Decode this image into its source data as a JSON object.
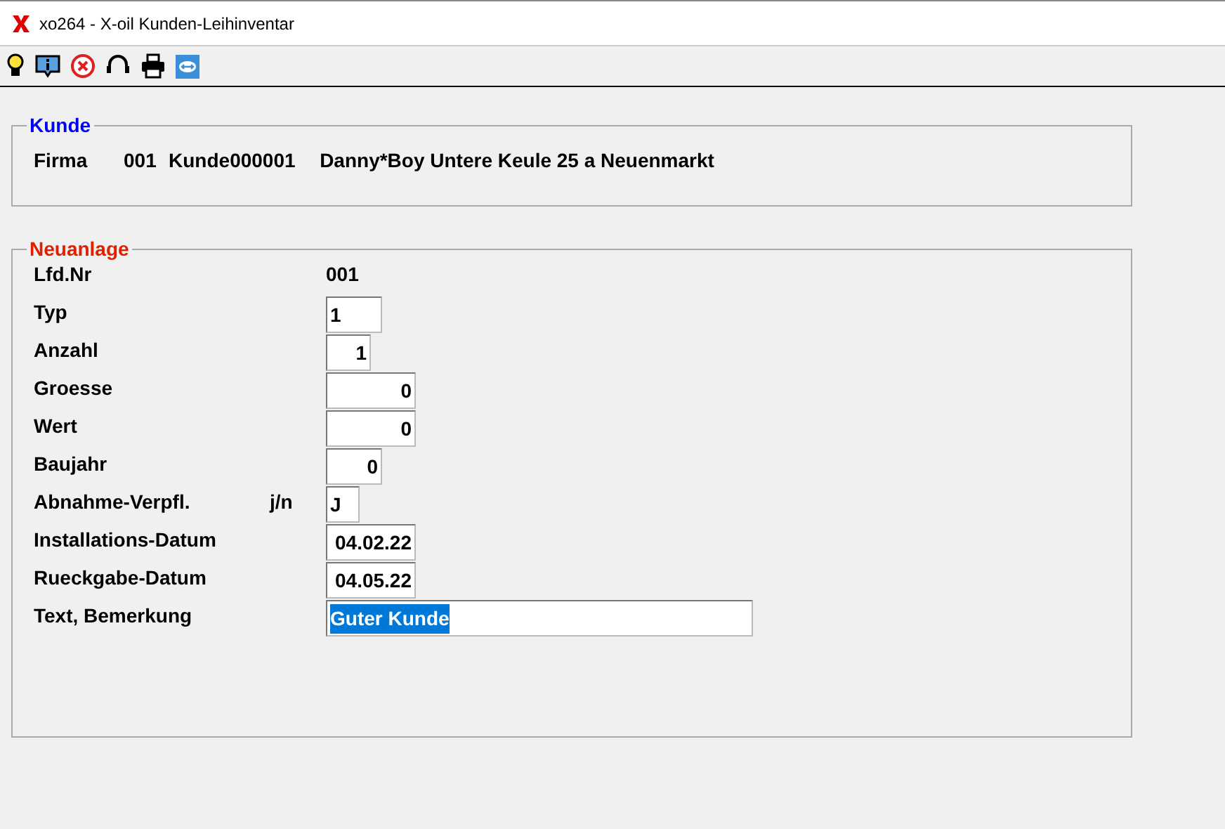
{
  "window": {
    "title": "xo264 - X-oil Kunden-Leihinventar"
  },
  "kunde": {
    "title": "Kunde",
    "firma_label": "Firma",
    "firma": "001",
    "kunde_label": "Kunde",
    "kunde_nr": "000001",
    "address": "Danny*Boy Untere Keule 25 a Neuenmarkt"
  },
  "neuanlage": {
    "title": "Neuanlage",
    "rows": [
      {
        "kind": "static",
        "label": "Lfd.Nr",
        "value": "001"
      },
      {
        "kind": "field",
        "label": "Typ",
        "value": "1"
      },
      {
        "kind": "field",
        "label": "Anzahl",
        "value": "1"
      },
      {
        "kind": "field",
        "label": "Groesse",
        "value": "0"
      },
      {
        "kind": "field",
        "label": "Wert",
        "value": "0"
      },
      {
        "kind": "field",
        "label": "Baujahr",
        "value": "0"
      },
      {
        "kind": "field",
        "label": "Abnahme-Verpfl.",
        "hint": "j/n",
        "value": "J"
      },
      {
        "kind": "field",
        "label": "Installations-Datum",
        "value": "04.02.22"
      },
      {
        "kind": "field",
        "label": "Rueckgabe-Datum",
        "value": "04.05.22"
      },
      {
        "kind": "field",
        "label": "Text, Bemerkung",
        "value": "Guter Kunde",
        "selected": true
      }
    ]
  }
}
